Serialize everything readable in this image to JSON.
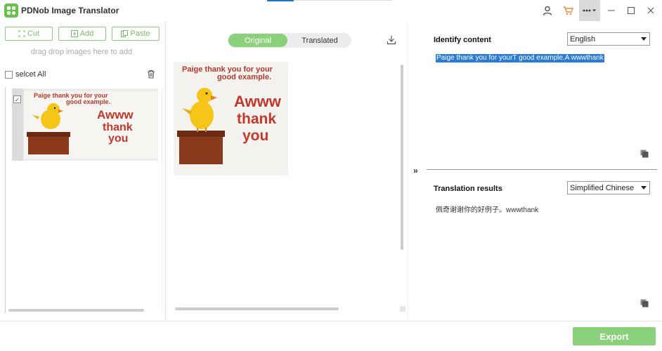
{
  "app": {
    "title": "PDNob Image Translator"
  },
  "titlebar": {
    "icons": [
      "user-icon",
      "cart-icon",
      "more-icon",
      "minimize-icon",
      "maximize-icon",
      "close-icon"
    ]
  },
  "sidebar": {
    "cut_label": "Cut",
    "add_label": "Add",
    "paste_label": "Paste",
    "drag_hint": "drag drop images here to add",
    "select_all_label": "selcet All",
    "image_text": {
      "line1": "Paige thank you for your",
      "line2": "good example.",
      "big1": "Awww",
      "big2": "thank",
      "big3": "you"
    }
  },
  "middle": {
    "tabs": {
      "original": "Original",
      "translated": "Translated"
    },
    "image_text": {
      "line1": "Paige thank you for your",
      "line2": "good example.",
      "big1": "Awww",
      "big2": "thank",
      "big3": "you"
    }
  },
  "right": {
    "identify_label": "Identify content",
    "source_language": "English",
    "recognized_text": "Paige thank you for yourT good example.A wwwthank",
    "results_label": "Translation results",
    "target_language": "Simplified Chinese",
    "translated_text": "佩奇谢谢你的好例子。wwwthank"
  },
  "footer": {
    "export_label": "Export"
  },
  "colors": {
    "accent": "#8bd07a",
    "selection": "#2a7ad8",
    "brand": "#6bbf4e"
  }
}
